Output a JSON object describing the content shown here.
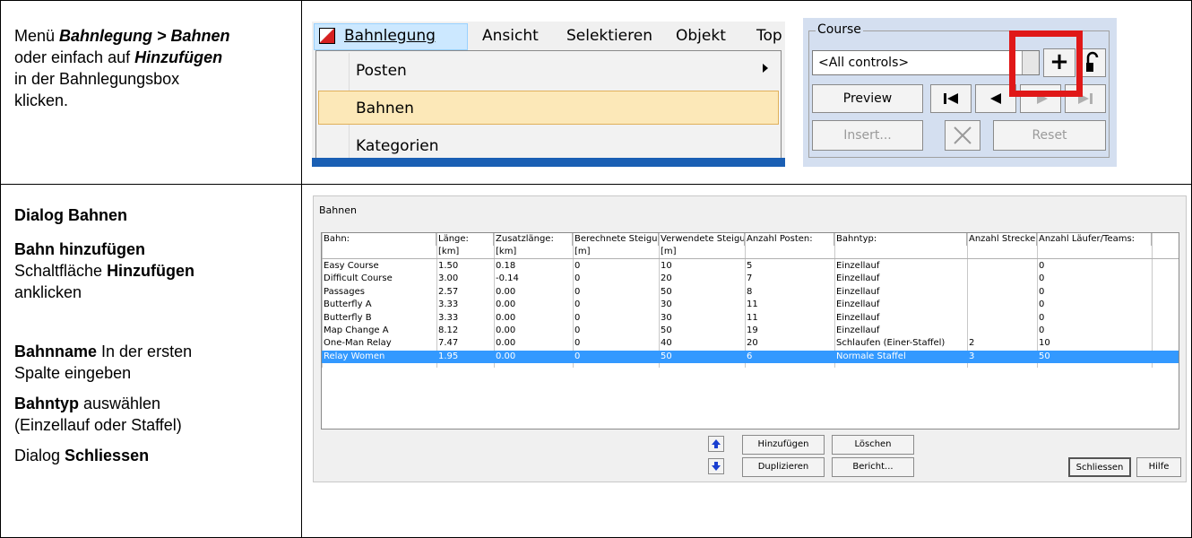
{
  "row1": {
    "text": {
      "l1_a": "Menü ",
      "l1_b": "Bahnlegung > Bahnen",
      "l2_a": "oder einfach auf ",
      "l2_b": "Hinzufügen",
      "l3": "in der Bahnlegungsbox",
      "l4": "klicken."
    },
    "menubar": [
      "Bahnlegung",
      "Ansicht",
      "Selektieren",
      "Objekt",
      "Top"
    ],
    "dropdown": [
      "Posten",
      "Bahnen",
      "Kategorien"
    ],
    "course_box": {
      "group_label": "Course",
      "combo_value": "<All controls>",
      "preview": "Preview",
      "insert": "Insert...",
      "reset": "Reset",
      "add_symbol": "+"
    }
  },
  "row2": {
    "text": {
      "dialog_title": "Dialog Bahnen",
      "add_title": "Bahn hinzufügen",
      "add_line_a": "Schaltfläche ",
      "add_line_b": "Hinzufügen",
      "add_line_c": "anklicken",
      "name_b": "Bahnname",
      "name_rest": " In der ersten",
      "name_line2": "Spalte eingeben",
      "type_b": "Bahntyp",
      "type_rest": " auswählen",
      "type_line2": "(Einzellauf oder Staffel)",
      "close_a": "Dialog ",
      "close_b": "Schliessen"
    },
    "dialog": {
      "title": "Bahnen",
      "columns": [
        "Bahn:",
        "Länge:",
        "Zusatzlänge:",
        "Berechnete Steigun",
        "Verwendete Steigu",
        "Anzahl Posten:",
        "Bahntyp:",
        "Anzahl Strecker",
        "Anzahl Läufer/Teams:"
      ],
      "units": [
        "",
        "[km]",
        "[km]",
        "[m]",
        "[m]",
        "",
        "",
        "",
        ""
      ],
      "rows": [
        [
          "Easy Course",
          "1.50",
          "0.18",
          "0",
          "10",
          "5",
          "Einzellauf",
          "",
          "0"
        ],
        [
          "Difficult Course",
          "3.00",
          "-0.14",
          "0",
          "20",
          "7",
          "Einzellauf",
          "",
          "0"
        ],
        [
          "Passages",
          "2.57",
          "0.00",
          "0",
          "50",
          "8",
          "Einzellauf",
          "",
          "0"
        ],
        [
          "Butterfly A",
          "3.33",
          "0.00",
          "0",
          "30",
          "11",
          "Einzellauf",
          "",
          "0"
        ],
        [
          "Butterfly B",
          "3.33",
          "0.00",
          "0",
          "30",
          "11",
          "Einzellauf",
          "",
          "0"
        ],
        [
          "Map Change A",
          "8.12",
          "0.00",
          "0",
          "50",
          "19",
          "Einzellauf",
          "",
          "0"
        ],
        [
          "One-Man Relay",
          "7.47",
          "0.00",
          "0",
          "40",
          "20",
          "Schlaufen (Einer-Staffel)",
          "2",
          "10"
        ],
        [
          "Relay Women",
          "1.95",
          "0.00",
          "0",
          "50",
          "6",
          "Normale Staffel",
          "3",
          "50"
        ]
      ],
      "buttons": {
        "add": "Hinzufügen",
        "delete": "Löschen",
        "duplicate": "Duplizieren",
        "report": "Bericht...",
        "close": "Schliessen",
        "help": "Hilfe"
      }
    }
  },
  "colors": {
    "selection": "#3399ff",
    "highlight_box": "#e01818",
    "menu_selected": "#fce8b8"
  }
}
